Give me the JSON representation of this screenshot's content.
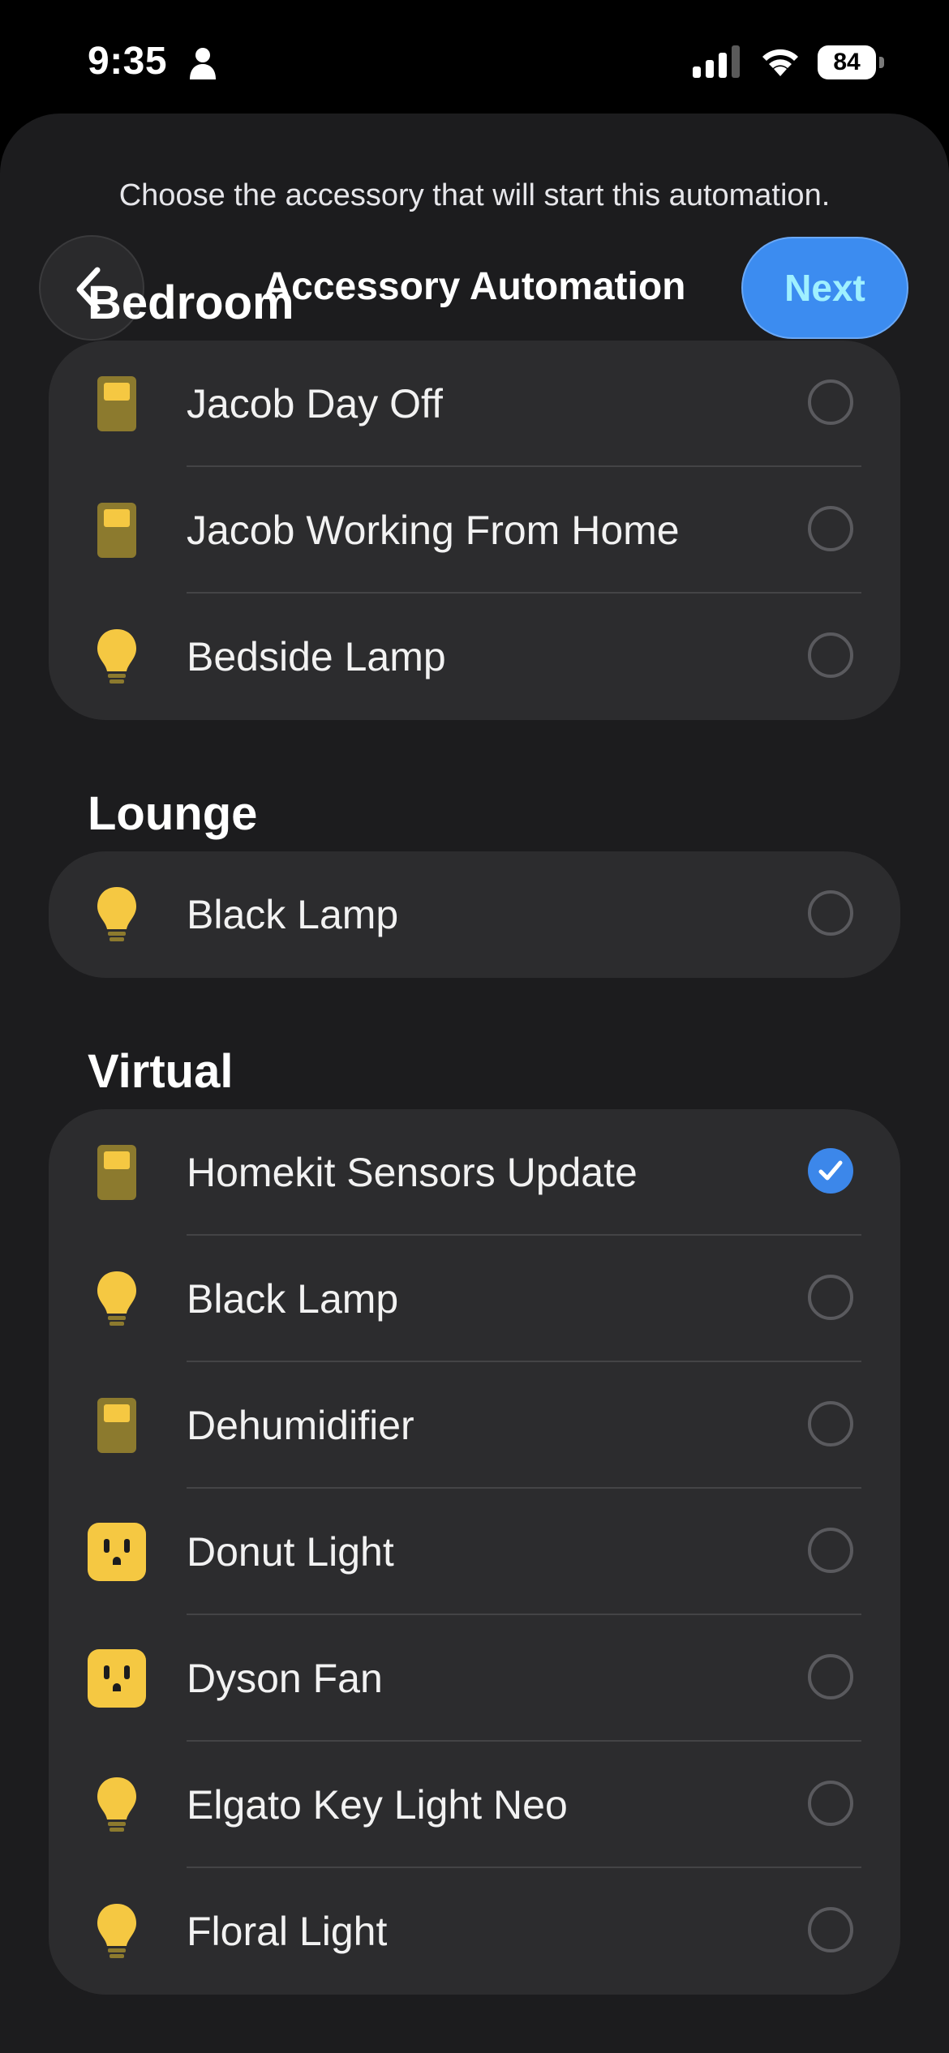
{
  "status_bar": {
    "time": "9:35",
    "battery": "84"
  },
  "header": {
    "subtitle": "Choose the accessory that will start this automation.",
    "title": "Accessory Automation",
    "next_label": "Next"
  },
  "sections": [
    {
      "title": "Bedroom",
      "items": [
        {
          "label": "Jacob Day Off",
          "icon": "switch-icon",
          "selected": false
        },
        {
          "label": "Jacob Working From Home",
          "icon": "switch-icon",
          "selected": false
        },
        {
          "label": "Bedside Lamp",
          "icon": "lightbulb-icon",
          "selected": false
        }
      ]
    },
    {
      "title": "Lounge",
      "items": [
        {
          "label": "Black Lamp",
          "icon": "lightbulb-icon",
          "selected": false
        }
      ]
    },
    {
      "title": "Virtual",
      "items": [
        {
          "label": "Homekit Sensors Update",
          "icon": "switch-icon",
          "selected": true
        },
        {
          "label": "Black Lamp",
          "icon": "lightbulb-icon",
          "selected": false
        },
        {
          "label": "Dehumidifier",
          "icon": "switch-icon",
          "selected": false
        },
        {
          "label": "Donut Light",
          "icon": "outlet-icon",
          "selected": false
        },
        {
          "label": "Dyson Fan",
          "icon": "outlet-icon",
          "selected": false
        },
        {
          "label": "Elgato Key Light Neo",
          "icon": "lightbulb-icon",
          "selected": false
        },
        {
          "label": "Floral Light",
          "icon": "lightbulb-icon",
          "selected": false
        }
      ]
    }
  ],
  "colors": {
    "accent": "#3c8cf0",
    "icon_yellow": "#f5c842",
    "icon_dim": "#8c7a2e"
  }
}
